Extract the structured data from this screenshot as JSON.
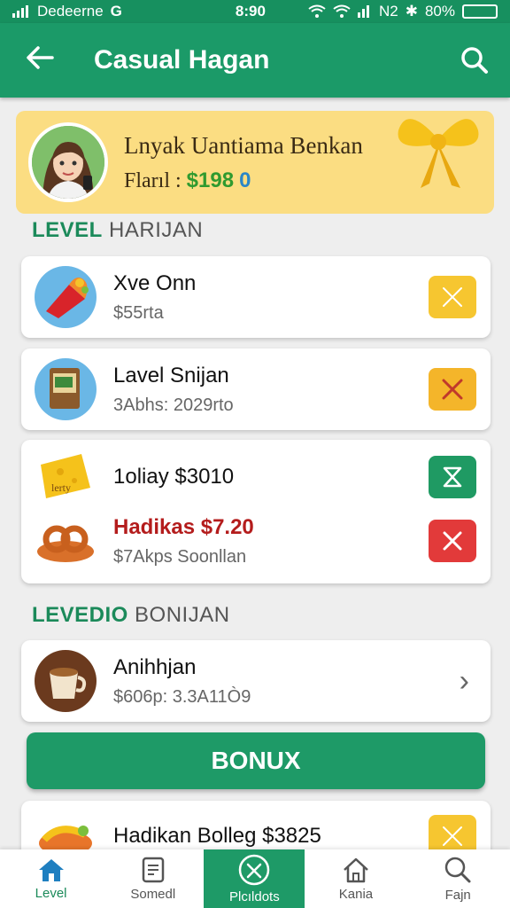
{
  "status_bar": {
    "carrier": "Dedeerne",
    "carrier_logo": "G",
    "time": "8:90",
    "network": "N2",
    "battery": "80%"
  },
  "app_bar": {
    "title": "Casual Hagan",
    "back_icon": "back-arrow-icon",
    "search_icon": "search-icon"
  },
  "profile": {
    "name": "Lnyak Uantiama Benkan",
    "balance_label": "Flarıl :",
    "balance_amount": "$198",
    "coin_symbol": "0"
  },
  "section_level": {
    "prefix": "LEVEL",
    "rest": "HARIJAN"
  },
  "level_items": [
    {
      "title": "Xve Onn",
      "subtitle": "$55rta",
      "action_color": "#f6c630"
    },
    {
      "title": "Lavel Snijan",
      "subtitle": "3Abhs: 2029rto",
      "action_color": "#f4b52a"
    },
    {
      "title": "1oliay $3010",
      "subtitle": "",
      "action_color": "#1f9a63"
    },
    {
      "title": "Hadikas $7.20",
      "subtitle": "$7Akps Soonllan",
      "action_color": "#e23a3a"
    }
  ],
  "section_bonus": {
    "prefix": "LEVEDIO",
    "rest": "BONIJAN"
  },
  "bonus_item": {
    "title": "Anihhjan",
    "subtitle": "$606p: 3.3A11Ò9"
  },
  "bonus_button": "BONUX",
  "partial_item": {
    "title": "Hadikan Bolleg $3825"
  },
  "bottom_nav": [
    {
      "label": "Level",
      "icon": "home-icon"
    },
    {
      "label": "Somedl",
      "icon": "document-icon"
    },
    {
      "label": "Plcıldots",
      "icon": "bonus-icon"
    },
    {
      "label": "Kania",
      "icon": "house-icon"
    },
    {
      "label": "Fajn",
      "icon": "search-icon"
    }
  ]
}
